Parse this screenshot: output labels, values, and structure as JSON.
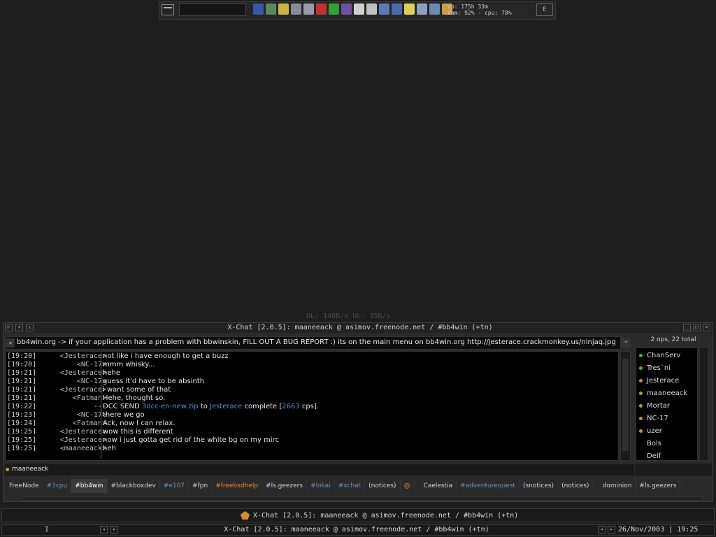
{
  "toolbar": {
    "system_info": "up: 175h 33m\nram: 92% - cpu: 78%",
    "right_button": "E",
    "tray_icons": [
      {
        "name": "shield-icon",
        "color": "#3a55a8"
      },
      {
        "name": "network-icon",
        "color": "#5a8a5a"
      },
      {
        "name": "speaker-icon",
        "color": "#c8b640"
      },
      {
        "name": "monitor-icon",
        "color": "#8a8a9a"
      },
      {
        "name": "computer-icon",
        "color": "#9a9aa8"
      },
      {
        "name": "kerio-icon",
        "color": "#c83030"
      },
      {
        "name": "triangle-icon",
        "color": "#30a030"
      },
      {
        "name": "people-icon",
        "color": "#7050a0"
      },
      {
        "name": "document-icon",
        "color": "#d0d0d0"
      },
      {
        "name": "funnel-icon",
        "color": "#c0c0c0"
      },
      {
        "name": "trash-icon",
        "color": "#5a7ab8"
      },
      {
        "name": "grid-icon",
        "color": "#4a6ab0"
      },
      {
        "name": "pause-icon",
        "color": "#e0d050"
      },
      {
        "name": "chart-icon",
        "color": "#8aa0c0"
      },
      {
        "name": "tools-icon",
        "color": "#6a8ab0"
      },
      {
        "name": "winamp-icon",
        "color": "#c8a040"
      }
    ]
  },
  "speeds": "DL: 148B/s  UL: 35B/s",
  "window": {
    "title": "X-Chat [2.0.5]: maaneeack @ asimov.freenode.net / #bb4win (+tn)",
    "left_buttons": [
      "⊢",
      "▾",
      "⌅"
    ],
    "right_buttons": [
      "_",
      "□",
      "×"
    ]
  },
  "topic": {
    "close": "×",
    "text": "bb4win.org -> if your application has a problem with bbwinskin, FILL OUT A BUG REPORT :) its on the main menu on bb4win.org http://jesterace.crackmonkey.us/ninjaq.jpg",
    "go_arrow": "➔"
  },
  "userlist": {
    "summary": "2 ops, 22 total",
    "users": [
      {
        "name": "ChanServ",
        "status_color": "#35c035"
      },
      {
        "name": "Tres`ni",
        "status_color": "#35c035"
      },
      {
        "name": "Jesterace",
        "status_color": "#b8963a"
      },
      {
        "name": "maaneeack",
        "status_color": "#b8963a"
      },
      {
        "name": "Mortar",
        "status_color": "#b8963a"
      },
      {
        "name": "NC-17",
        "status_color": "#b8963a"
      },
      {
        "name": "uzer",
        "status_color": "#b8963a"
      },
      {
        "name": "Bols",
        "status_color": ""
      },
      {
        "name": "Delf",
        "status_color": ""
      }
    ]
  },
  "chat": [
    {
      "time": "[19:20]",
      "nick": "<Jesterace>",
      "msg": "not like i have enough to get a buzz"
    },
    {
      "time": "[19:20]",
      "nick": "<NC-17>",
      "msg": "mmm whisky..."
    },
    {
      "time": "[19:21]",
      "nick": "<Jesterace>",
      "msg": "hehe"
    },
    {
      "time": "[19:21]",
      "nick": "<NC-17>",
      "msg": "guess it'd have to be absinth"
    },
    {
      "time": "[19:21]",
      "nick": "<Jesterace>",
      "msg": "i want some of that"
    },
    {
      "time": "[19:21]",
      "nick": "<Fatman>",
      "msg": "Hehe, thought so."
    },
    {
      "time": "[19:22]",
      "nick": "---",
      "dcc": {
        "a": "DCC SEND ",
        "file": "3dcc-en-new.zip",
        "b": " to ",
        "user": "Jesterace",
        "c": " complete [",
        "cps": "2663",
        "d": " cps]."
      }
    },
    {
      "time": "[19:23]",
      "nick": "<NC-17>",
      "msg": "there we go"
    },
    {
      "time": "[19:24]",
      "nick": "<Fatman>",
      "msg": "Ack, now I can relax."
    },
    {
      "time": "[19:25]",
      "nick": "<Jesterace>",
      "msg": "wow this is different"
    },
    {
      "time": "[19:25]",
      "nick": "<Jesterace>",
      "msg": "now i just gotta get rid of the white bg on my mirc"
    },
    {
      "time": "[19:25]",
      "nick": "<maaneeack>",
      "msg": "heh"
    }
  ],
  "input": {
    "nick": "maaneeack",
    "value": ""
  },
  "tabs": [
    {
      "label": "FreeNode",
      "style": ""
    },
    {
      "label": "#3cpu",
      "style": "dim"
    },
    {
      "label": "#bb4win",
      "style": "active"
    },
    {
      "label": "#blackboxdev",
      "style": ""
    },
    {
      "label": "#e107",
      "style": "dim"
    },
    {
      "label": "#fpn",
      "style": ""
    },
    {
      "label": "#freebsdhelp",
      "style": "hl"
    },
    {
      "label": "#ls.geezers",
      "style": ""
    },
    {
      "label": "#lokai",
      "style": "dim"
    },
    {
      "label": "#xchat",
      "style": "dim"
    },
    {
      "label": "(notices)",
      "style": ""
    },
    {
      "label": "@",
      "style": "hl"
    },
    {
      "label": "Caelestia",
      "style": "gap"
    },
    {
      "label": "#adventurequest",
      "style": "dim"
    },
    {
      "label": "(snotices)",
      "style": ""
    },
    {
      "label": "(notices)",
      "style": ""
    },
    {
      "label": "dominion",
      "style": "gap"
    },
    {
      "label": "#ls.geezers",
      "style": ""
    }
  ],
  "taskbar": {
    "title": "X-Chat [2.0.5]: maaneeack @ asimov.freenode.net / #bb4win (+tn)",
    "workspace": "I",
    "arrows": [
      "◂",
      "▸"
    ],
    "title2": "X-Chat [2.0.5]: maaneeack @ asimov.freenode.net / #bb4win (+tn)",
    "clock": "26/Nov/2003 | 19:25"
  }
}
